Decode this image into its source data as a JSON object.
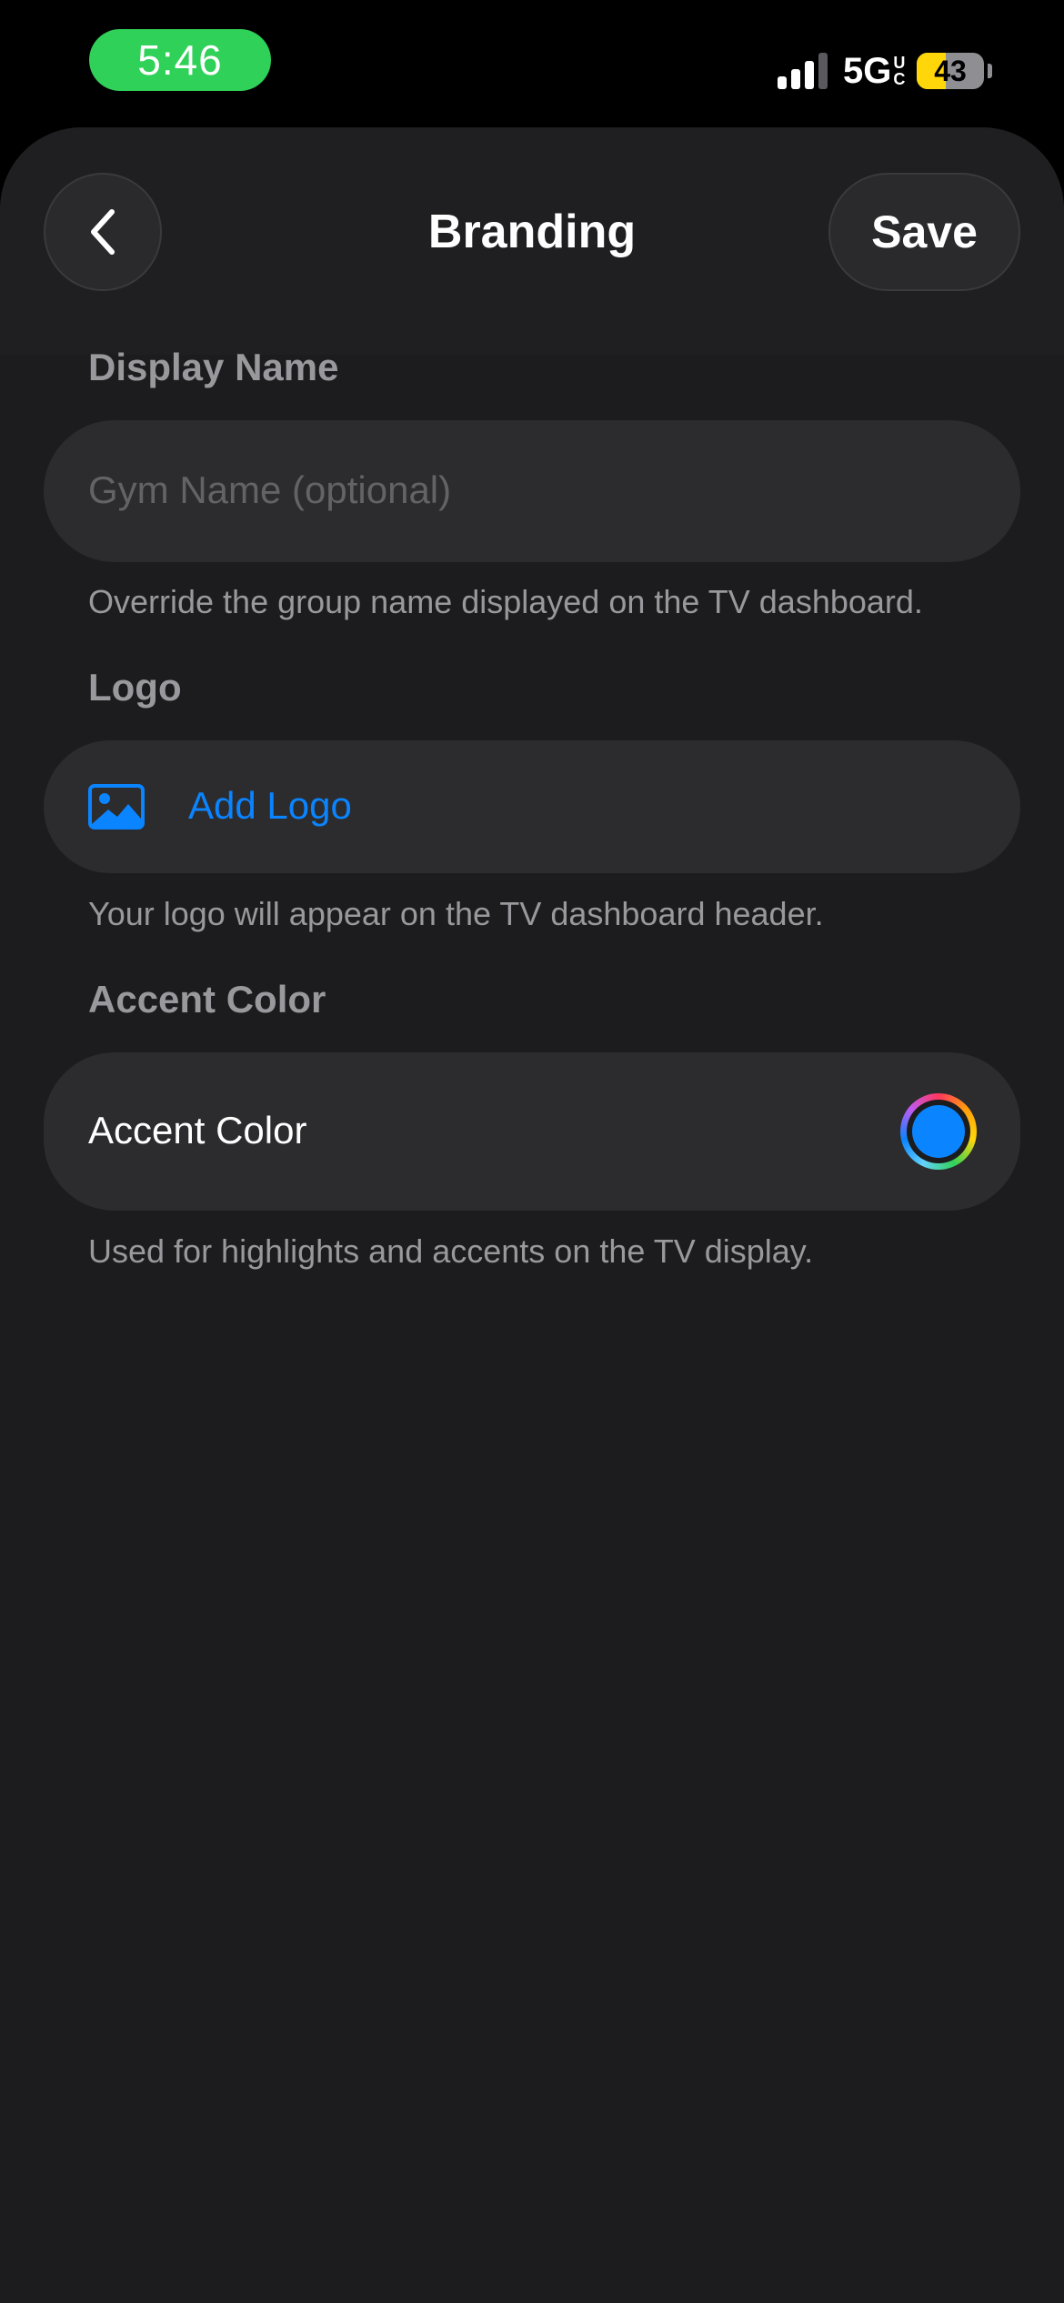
{
  "status_bar": {
    "time": "5:46",
    "network": "5G",
    "network_sup": "U",
    "network_sub": "C",
    "battery": "43",
    "battery_level": 0.43
  },
  "nav": {
    "title": "Branding",
    "save_label": "Save",
    "back_icon": "chevron-left-icon"
  },
  "display_name": {
    "section_label": "Display Name",
    "placeholder": "Gym Name (optional)",
    "value": "",
    "helper": "Override the group name displayed on the TV dashboard."
  },
  "logo": {
    "section_label": "Logo",
    "button_label": "Add Logo",
    "icon": "photo-icon",
    "helper": "Your logo will appear on the TV dashboard header."
  },
  "accent_color": {
    "section_label": "Accent Color",
    "row_label": "Accent Color",
    "selected_color": "#0a84ff",
    "helper": "Used for highlights and accents on the TV display."
  },
  "colors": {
    "background": "#1c1c1e",
    "field": "#2c2c2e",
    "accent": "#0a84ff",
    "secondary_text": "#98989d",
    "time_pill": "#30d158"
  }
}
